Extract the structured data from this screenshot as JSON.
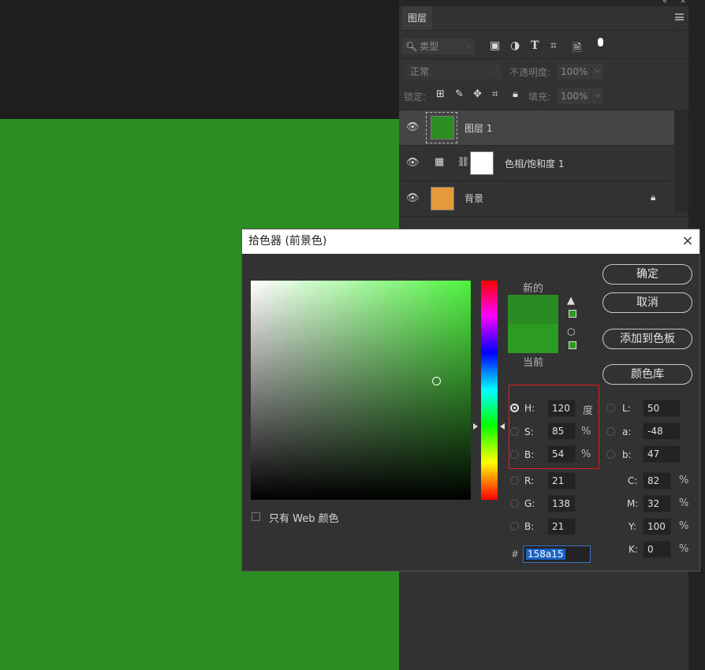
{
  "layers_panel": {
    "tab": "图层",
    "filter_kind": "类型",
    "blend_mode": "正常",
    "opacity_label": "不透明度:",
    "opacity_value": "100%",
    "lock_label": "锁定:",
    "fill_label": "填充:",
    "fill_value": "100%",
    "layers": [
      {
        "name": "图层 1",
        "thumb_color": "#2c8d22",
        "selected": true
      },
      {
        "name": "色相/饱和度 1",
        "thumb_color": "#ffffff",
        "selected": false
      },
      {
        "name": "背景",
        "thumb_color": "#e29a3a",
        "selected": false
      }
    ]
  },
  "color_picker": {
    "title": "拾色器 (前景色)",
    "new_label": "新的",
    "current_label": "当前",
    "buttons": {
      "ok": "确定",
      "cancel": "取消",
      "add_swatch": "添加到色板",
      "library": "颜色库"
    },
    "hsb": [
      {
        "label": "H:",
        "value": "120",
        "unit": "度",
        "checked": true
      },
      {
        "label": "S:",
        "value": "85",
        "unit": "%",
        "checked": false
      },
      {
        "label": "B:",
        "value": "54",
        "unit": "%",
        "checked": false
      }
    ],
    "rgb": [
      {
        "label": "R:",
        "value": "21"
      },
      {
        "label": "G:",
        "value": "138"
      },
      {
        "label": "B:",
        "value": "21"
      }
    ],
    "lab": [
      {
        "label": "L:",
        "value": "50"
      },
      {
        "label": "a:",
        "value": "-48"
      },
      {
        "label": "b:",
        "value": "47"
      }
    ],
    "cmyk": [
      {
        "label": "C:",
        "value": "82",
        "unit": "%"
      },
      {
        "label": "M:",
        "value": "32",
        "unit": "%"
      },
      {
        "label": "Y:",
        "value": "100",
        "unit": "%"
      },
      {
        "label": "K:",
        "value": "0",
        "unit": "%"
      }
    ],
    "hex_label": "#",
    "hex_value": "158a15",
    "web_only_label": "只有 Web 颜色",
    "new_color": "#2a8a24",
    "current_color": "#2c9b22"
  },
  "icons": [
    "search-icon",
    "image-filter-icon",
    "adjust-filter-icon",
    "type-filter-icon",
    "shape-filter-icon",
    "smart-filter-icon",
    "toggle-icon",
    "eye-icon",
    "lock-icon",
    "warning-icon",
    "cube-icon",
    "close-icon",
    "panel-menu-icon"
  ]
}
